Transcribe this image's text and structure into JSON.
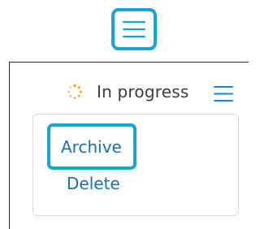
{
  "toolbar": {
    "menu_icon": "hamburger-icon"
  },
  "status": {
    "icon": "loading-spinner-icon",
    "label": "In progress"
  },
  "panel_menu": {
    "icon": "hamburger-icon"
  },
  "dropdown": {
    "items": [
      {
        "label": "Archive",
        "focused": true
      },
      {
        "label": "Delete",
        "focused": false
      }
    ]
  },
  "colors": {
    "accent": "#15a6cf",
    "link": "#1b6fb0",
    "spinner": "#f5a623",
    "text": "#3b3b3b"
  }
}
